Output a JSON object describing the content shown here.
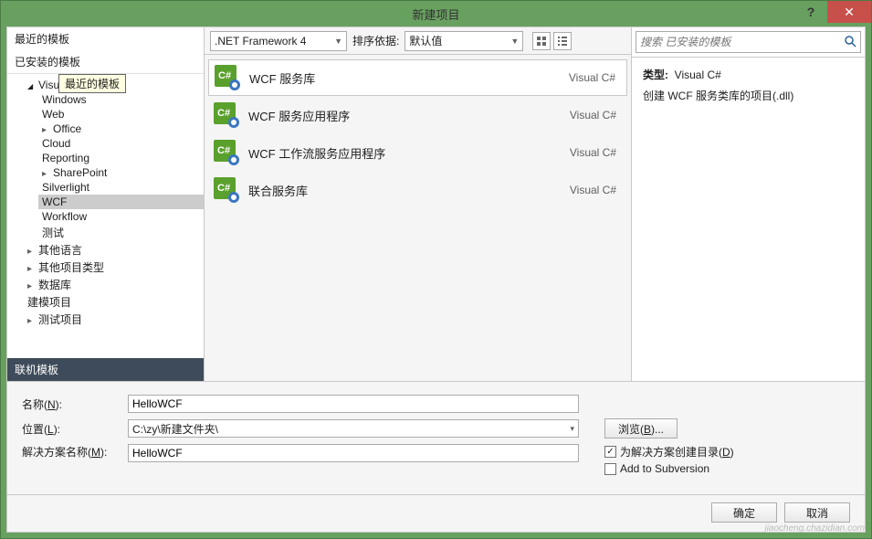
{
  "title": "新建项目",
  "left": {
    "recent": "最近的模板",
    "installed": "已安装的模板",
    "tooltip": "最近的模板",
    "visual_csharp": "Visual C#",
    "items": [
      "Windows",
      "Web",
      "Office",
      "Cloud",
      "Reporting",
      "SharePoint",
      "Silverlight",
      "WCF",
      "Workflow",
      "测试"
    ],
    "other_lang": "其他语言",
    "other_proj": "其他项目类型",
    "database": "数据库",
    "modeling": "建模项目",
    "test_proj": "测试项目",
    "online": "联机模板"
  },
  "toolbar": {
    "framework": ".NET Framework 4",
    "sort_label": "排序依据:",
    "sort_value": "默认值"
  },
  "templates": [
    {
      "name": "WCF 服务库",
      "lang": "Visual C#",
      "selected": true
    },
    {
      "name": "WCF 服务应用程序",
      "lang": "Visual C#",
      "selected": false
    },
    {
      "name": "WCF 工作流服务应用程序",
      "lang": "Visual C#",
      "selected": false
    },
    {
      "name": "联合服务库",
      "lang": "Visual C#",
      "selected": false
    }
  ],
  "search": {
    "placeholder": "搜索 已安装的模板"
  },
  "right": {
    "type_label": "类型:",
    "type_value": "Visual C#",
    "description": "创建 WCF 服务类库的项目(.dll)"
  },
  "form": {
    "name_label": "名称(N):",
    "name_value": "HelloWCF",
    "loc_label": "位置(L):",
    "loc_value": "C:\\zy\\新建文件夹\\",
    "browse": "浏览(B)...",
    "sol_label": "解决方案名称(M):",
    "sol_value": "HelloWCF",
    "chk_dir": "为解决方案创建目录(D)",
    "chk_svn": "Add to Subversion"
  },
  "buttons": {
    "ok": "确定",
    "cancel": "取消"
  },
  "watermark": "jiaocheng.chazidian.com"
}
